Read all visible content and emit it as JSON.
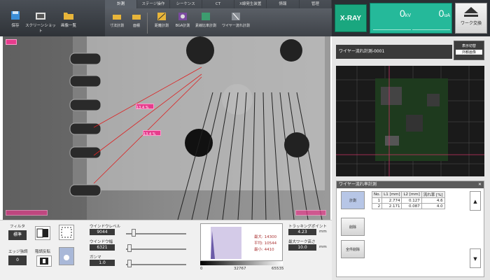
{
  "toolbar": {
    "save": "保存",
    "screenshot": "スクリーンショット",
    "gallery": "画像一覧",
    "tabs": [
      "計測",
      "ステージ操作",
      "シーケンス",
      "CT",
      "X線発生装置",
      "情報",
      "管理"
    ],
    "ribbon": [
      "寸法計測",
      "面積",
      "距離計測",
      "BGA計測",
      "素線比率計測",
      "ワイヤー流れ計測"
    ]
  },
  "xray": {
    "label": "X-RAY",
    "kv": "0",
    "kv_unit": "kV",
    "ua": "0",
    "ua_unit": "uA",
    "work_change": "ワーク交換"
  },
  "view": {
    "label1": "13.4 %",
    "label2": "13.4 %"
  },
  "controls": {
    "filter": "フィルタ",
    "filter_val": "標準",
    "edge": "エッジ強調",
    "edge_val": "0",
    "invert": "階調反転",
    "window_level": "ウインドウレベル",
    "window_level_val": "9044",
    "window_width": "ウインドウ幅",
    "window_width_val": "6321",
    "gamma": "ガンマ",
    "gamma_val": "1.0",
    "hist_max_label": "最大:",
    "hist_max": "14300",
    "hist_avg_label": "平均:",
    "hist_avg": "10544",
    "hist_min_label": "最小:",
    "hist_min": "4410",
    "axis_0": "0",
    "axis_mid": "32767",
    "axis_max": "65535",
    "tracking": "トラッキングポイント",
    "tracking_val": "4.23",
    "max_work": "最大ワーク高さ",
    "max_work_val": "10.0",
    "unit": "mm"
  },
  "right": {
    "title": "ワイヤー流れ計測-0001",
    "display_switch": "表示切替",
    "display_mode": "外観画像",
    "panel_title": "ワイヤー流れ率計測",
    "btn_measure": "計測",
    "btn_delete": "削除",
    "btn_delete_all": "全件削除",
    "headers": [
      "No.",
      "L1 [mm]",
      "L2 [mm]",
      "流れ率 [%]"
    ],
    "rows": [
      [
        "1",
        "2.774",
        "0.127",
        "4.6"
      ],
      [
        "2",
        "2.171",
        "0.087",
        "4.0"
      ]
    ]
  },
  "colors": {
    "accent": "#25b99a",
    "dark": "#2b2f34"
  }
}
